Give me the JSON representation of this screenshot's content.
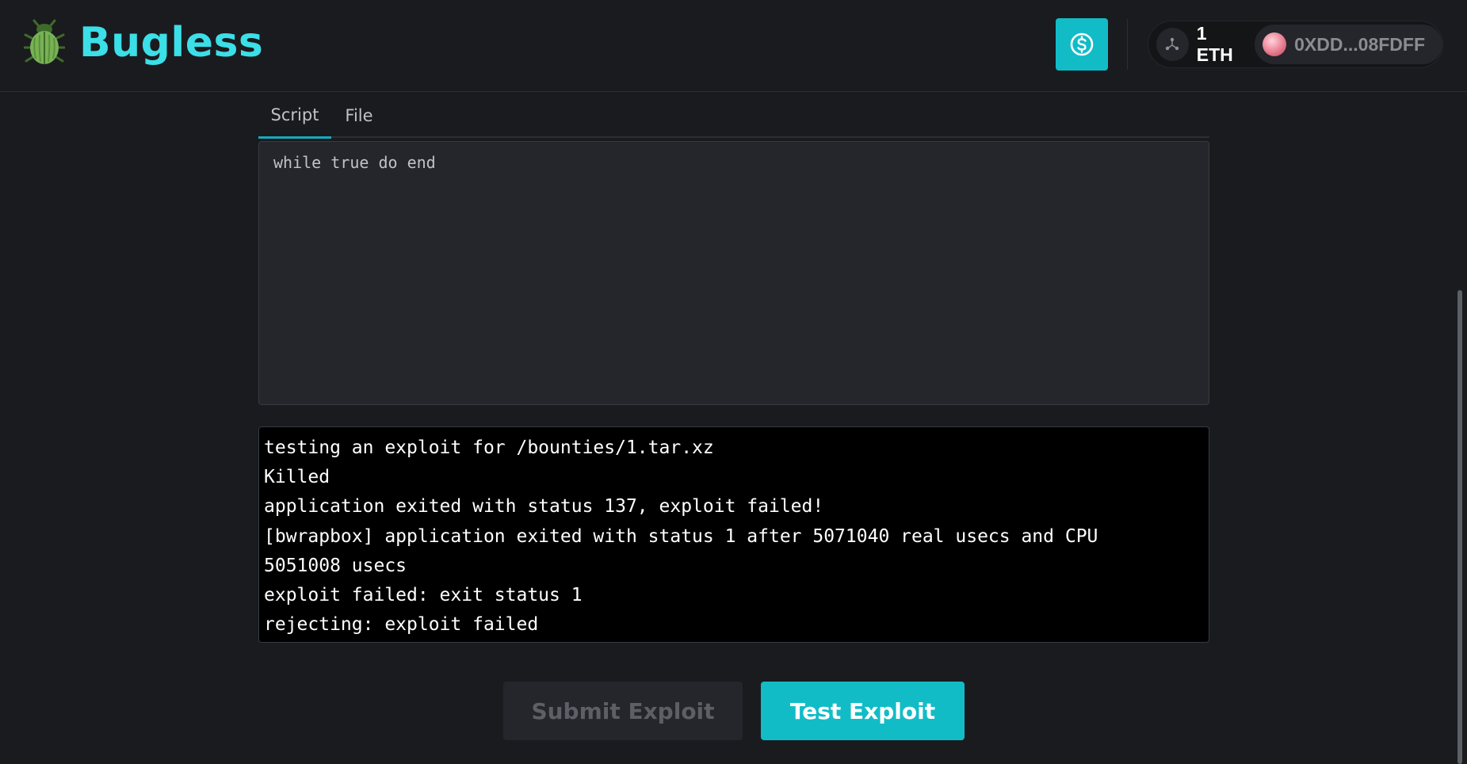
{
  "app": {
    "name": "Bugless",
    "logo_icon": "beetle-icon",
    "accent": "#3bdfe8"
  },
  "header": {
    "faucet_icon": "dollar-circle-icon",
    "network_icon": "network-icon",
    "balance": "1 ETH",
    "address": "0XDD...08FDFF"
  },
  "tabs": [
    {
      "label": "Script",
      "active": true
    },
    {
      "label": "File",
      "active": false
    }
  ],
  "editor": {
    "content": "while true do end"
  },
  "console": {
    "lines": [
      "testing an exploit for /bounties/1.tar.xz",
      "Killed",
      "application exited with status 137, exploit failed!",
      "[bwrapbox] application exited with status 1 after 5071040 real usecs and CPU",
      "5051008 usecs",
      "exploit failed: exit status 1",
      "rejecting: exploit failed"
    ]
  },
  "actions": {
    "submit_label": "Submit Exploit",
    "submit_disabled": true,
    "test_label": "Test Exploit",
    "test_color": "#12bcc7"
  }
}
